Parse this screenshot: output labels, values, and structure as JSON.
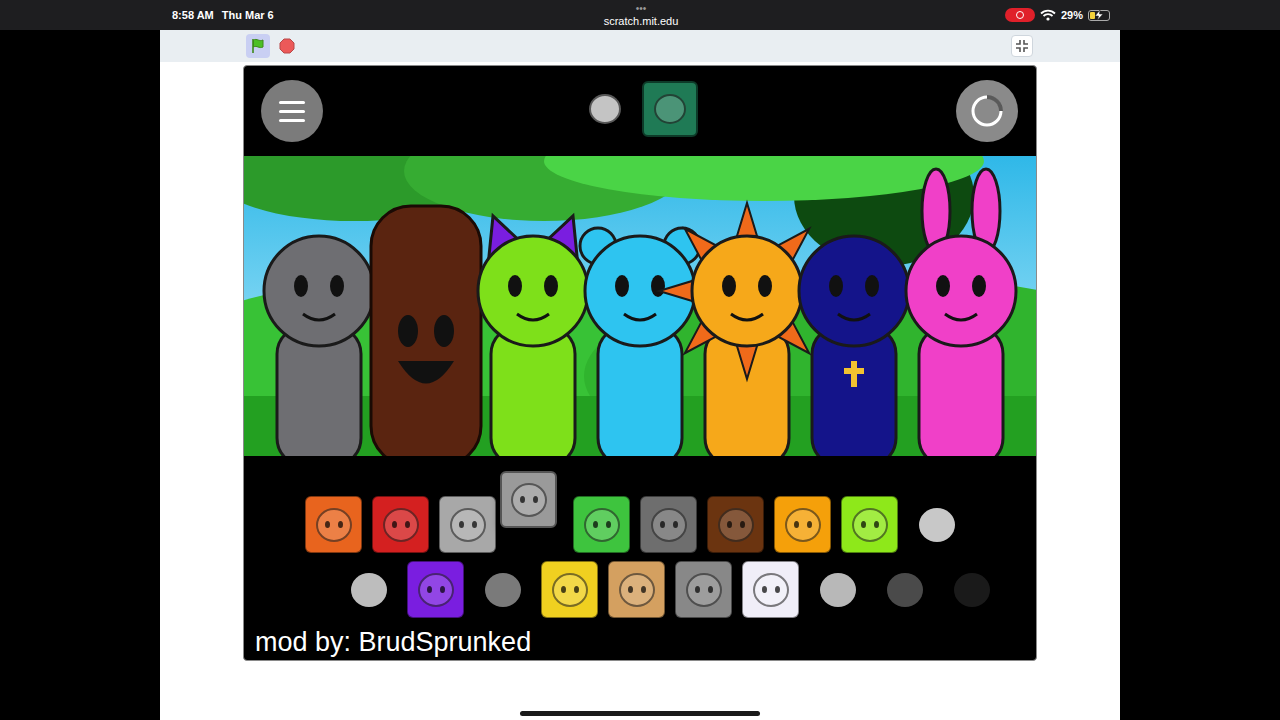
{
  "status_bar": {
    "time": "8:58 AM",
    "date": "Thu Mar 6",
    "dots": "•••",
    "url": "scratch.mit.edu",
    "recording": true,
    "battery": "29%",
    "battery_level": 0.29,
    "charging": true
  },
  "player": {
    "running": true
  },
  "stage": {
    "selected_slots": [
      {
        "kind": "silhouette",
        "color": "#c4c4c4"
      },
      {
        "kind": "tile",
        "color": "#1f7a55"
      }
    ],
    "scene": {
      "characters": [
        {
          "kind": "pole",
          "color": "#6e6e72"
        },
        {
          "kind": "tree",
          "color": "#5a2410"
        },
        {
          "kind": "cat",
          "color": "#7ee01a"
        },
        {
          "kind": "bear",
          "color": "#2ec4f0"
        },
        {
          "kind": "sun",
          "color": "#f6a81a"
        },
        {
          "kind": "hood",
          "color": "#14148a"
        },
        {
          "kind": "bunny",
          "color": "#f040c8"
        }
      ]
    },
    "icon_rows": [
      [
        {
          "kind": "tile",
          "color": "#e8641e",
          "lifted": false
        },
        {
          "kind": "tile",
          "color": "#d42020",
          "lifted": false
        },
        {
          "kind": "tile",
          "color": "#a8a8a8",
          "lifted": false
        },
        {
          "kind": "tile",
          "color": "#9a9a9a",
          "lifted": true
        },
        {
          "kind": "tile",
          "color": "#3ec43e",
          "lifted": false
        },
        {
          "kind": "tile",
          "color": "#6e6e6e",
          "lifted": false
        },
        {
          "kind": "tile",
          "color": "#6b3410",
          "lifted": false
        },
        {
          "kind": "tile",
          "color": "#f5a00a",
          "lifted": false
        },
        {
          "kind": "tile",
          "color": "#8ee81a",
          "lifted": false
        },
        {
          "kind": "silhouette",
          "color": "#c8c8c8",
          "lifted": false
        }
      ],
      [
        {
          "kind": "silhouette",
          "color": "#bdbdbd",
          "lifted": false
        },
        {
          "kind": "tile",
          "color": "#7a1ee0",
          "lifted": false
        },
        {
          "kind": "silhouette",
          "color": "#7a7a7a",
          "lifted": false
        },
        {
          "kind": "tile",
          "color": "#f0d020",
          "lifted": false
        },
        {
          "kind": "tile",
          "color": "#d4a060",
          "lifted": false
        },
        {
          "kind": "tile",
          "color": "#888888",
          "lifted": false
        },
        {
          "kind": "tile",
          "color": "#f0eef8",
          "lifted": false
        },
        {
          "kind": "silhouette",
          "color": "#b8b8b8",
          "lifted": false
        },
        {
          "kind": "silhouette",
          "color": "#4a4a4a",
          "lifted": false
        },
        {
          "kind": "silhouette",
          "color": "#1a1a1a",
          "lifted": false
        }
      ]
    ],
    "credit": "mod by: BrudSprunked"
  }
}
